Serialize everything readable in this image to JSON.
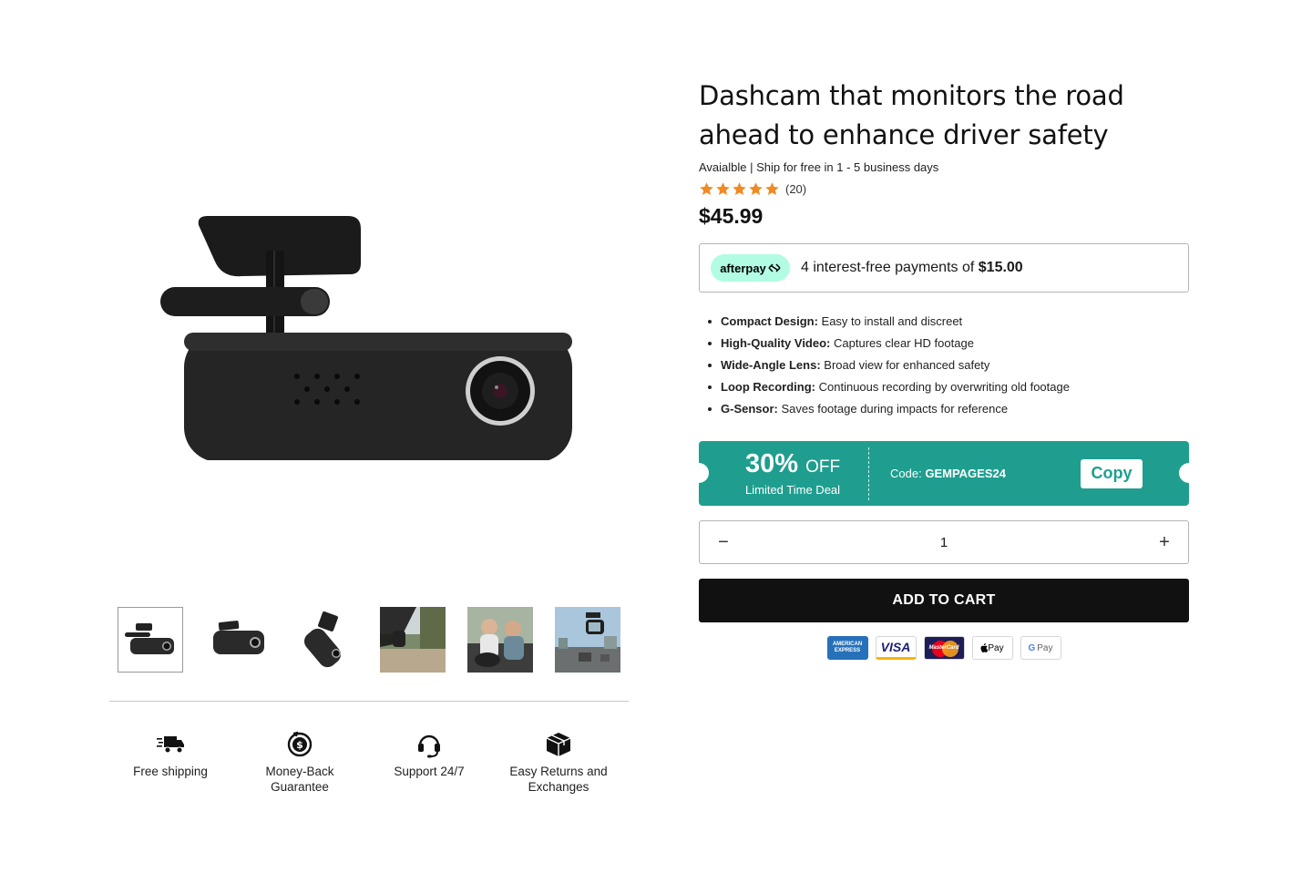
{
  "product": {
    "title": "Dashcam that monitors the road ahead to enhance driver safety",
    "availability": "Avaialble | Ship for free in 1 - 5 business days",
    "rating_stars": 5,
    "review_count": "(20)",
    "price": "$45.99"
  },
  "afterpay": {
    "logo_text": "afterpay",
    "text": "4 interest-free payments of",
    "amount": "$15.00"
  },
  "bullets": [
    {
      "label": "Compact Design:",
      "text": "Easy to install and discreet"
    },
    {
      "label": "High-Quality Video:",
      "text": "Captures clear HD footage"
    },
    {
      "label": "Wide-Angle Lens:",
      "text": "Broad view for enhanced safety"
    },
    {
      "label": "Loop Recording:",
      "text": "Continuous recording by overwriting old footage"
    },
    {
      "label": "G-Sensor:",
      "text": "Saves footage during impacts for reference"
    }
  ],
  "coupon": {
    "percent": "30%",
    "off": "OFF",
    "subtitle": "Limited Time Deal",
    "code_label": "Code:",
    "code": "GEMPAGES24",
    "copy_label": "Copy",
    "color": "#1f9e8f"
  },
  "quantity": {
    "minus": "−",
    "value": "1",
    "plus": "+"
  },
  "add_to_cart": "ADD TO CART",
  "payment_methods": [
    {
      "name": "amex-icon",
      "label": "AMERICAN EXPRESS"
    },
    {
      "name": "visa-icon",
      "label": "VISA"
    },
    {
      "name": "mastercard-icon",
      "label": "MasterCard"
    },
    {
      "name": "apple-pay-icon",
      "label": "Pay"
    },
    {
      "name": "google-pay-icon",
      "label": "Pay"
    }
  ],
  "features": [
    {
      "icon": "truck-icon",
      "label": "Free shipping"
    },
    {
      "icon": "money-back-icon",
      "label": "Money-Back Guarantee"
    },
    {
      "icon": "headset-icon",
      "label": "Support 24/7"
    },
    {
      "icon": "box-icon",
      "label": "Easy Returns and Exchanges"
    }
  ],
  "colors": {
    "accent": "#1f9e8f",
    "star": "#f08a24",
    "button": "#111111",
    "afterpay": "#b2fce4"
  }
}
